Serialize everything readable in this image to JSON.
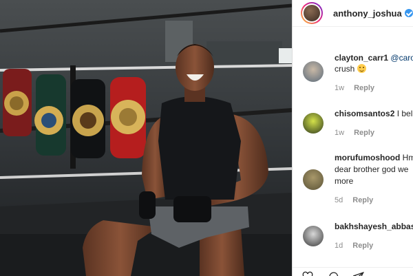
{
  "post": {
    "username": "anthony_joshua",
    "separator": "•"
  },
  "comments": [
    {
      "username": "clayton_carr1",
      "mention": "@carol",
      "line2": "crush",
      "age": "1w",
      "reply_label": "Reply"
    },
    {
      "username": "chisomsantos2",
      "text": "I beli",
      "age": "1w",
      "reply_label": "Reply"
    },
    {
      "username": "morufumoshood",
      "text": "Hm",
      "line2": "dear brother god we",
      "line3": "more",
      "age": "5d",
      "reply_label": "Reply"
    },
    {
      "username": "bakhshayesh_abbas",
      "age": "1d",
      "reply_label": "Reply"
    }
  ],
  "icons": {
    "verified": "verified-badge-icon",
    "emoji": "smiling-face-emoji",
    "like": "heart-icon",
    "comment": "comment-icon",
    "share": "share-icon"
  },
  "colors": {
    "verified": "#3897f0",
    "text": "#262626",
    "muted": "#8e8e8e",
    "mention": "#00376b"
  }
}
